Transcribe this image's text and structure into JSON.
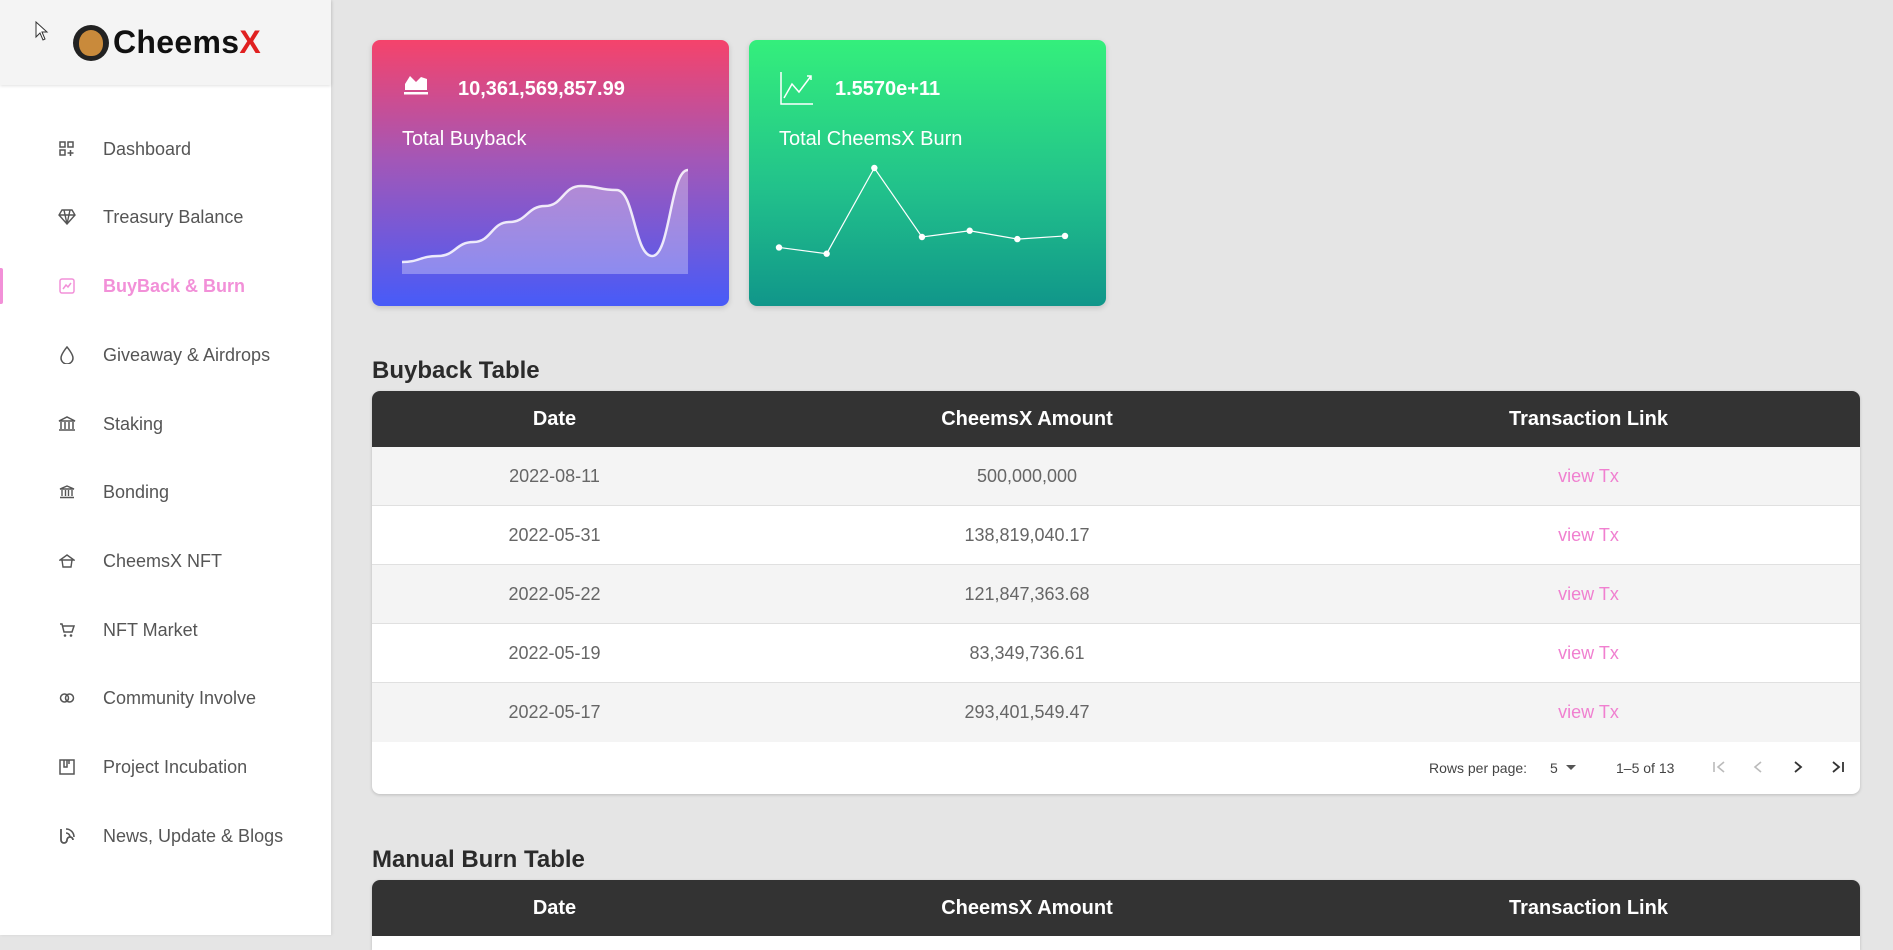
{
  "brand": {
    "name_main": "Cheems",
    "name_x": "X"
  },
  "nav": [
    {
      "label": "Dashboard",
      "icon": "dashboard-icon",
      "active": false
    },
    {
      "label": "Treasury Balance",
      "icon": "diamond-icon",
      "active": false
    },
    {
      "label": "BuyBack & Burn",
      "icon": "burn-icon",
      "active": true
    },
    {
      "label": "Giveaway & Airdrops",
      "icon": "drop-icon",
      "active": false
    },
    {
      "label": "Staking",
      "icon": "bank-icon",
      "active": false
    },
    {
      "label": "Bonding",
      "icon": "bank-small-icon",
      "active": false
    },
    {
      "label": "CheemsX NFT",
      "icon": "temple-icon",
      "active": false
    },
    {
      "label": "NFT Market",
      "icon": "cart-icon",
      "active": false
    },
    {
      "label": "Community Involve",
      "icon": "rings-icon",
      "active": false
    },
    {
      "label": "Project Incubation",
      "icon": "incubation-icon",
      "active": false
    },
    {
      "label": "News, Update & Blogs",
      "icon": "blog-icon",
      "active": false
    }
  ],
  "cards": {
    "buyback": {
      "value": "10,361,569,857.99",
      "caption": "Total Buyback",
      "icon": "area-chart-icon",
      "spark": [
        2,
        5,
        12,
        22,
        30,
        40,
        38,
        5,
        48
      ]
    },
    "burn": {
      "value": "1.5570e+11",
      "caption": "Total CheemsX Burn",
      "icon": "line-chart-icon",
      "spark": [
        12,
        6,
        88,
        22,
        28,
        20,
        23
      ]
    }
  },
  "buyback_table": {
    "title": "Buyback Table",
    "columns": [
      "Date",
      "CheemsX Amount",
      "Transaction Link"
    ],
    "rows": [
      [
        "2022-08-11",
        "500,000,000",
        "view Tx"
      ],
      [
        "2022-05-31",
        "138,819,040.17",
        "view Tx"
      ],
      [
        "2022-05-22",
        "121,847,363.68",
        "view Tx"
      ],
      [
        "2022-05-19",
        "83,349,736.61",
        "view Tx"
      ],
      [
        "2022-05-17",
        "293,401,549.47",
        "view Tx"
      ]
    ],
    "pager": {
      "rows_per_page_label": "Rows per page:",
      "rows_per_page": "5",
      "range": "1–5 of 13"
    }
  },
  "burn_table": {
    "title": "Manual Burn Table",
    "columns": [
      "Date",
      "CheemsX Amount",
      "Transaction Link"
    ]
  },
  "colors": {
    "accent": "#f290d8",
    "header": "#333333",
    "link": "#f080d0"
  }
}
